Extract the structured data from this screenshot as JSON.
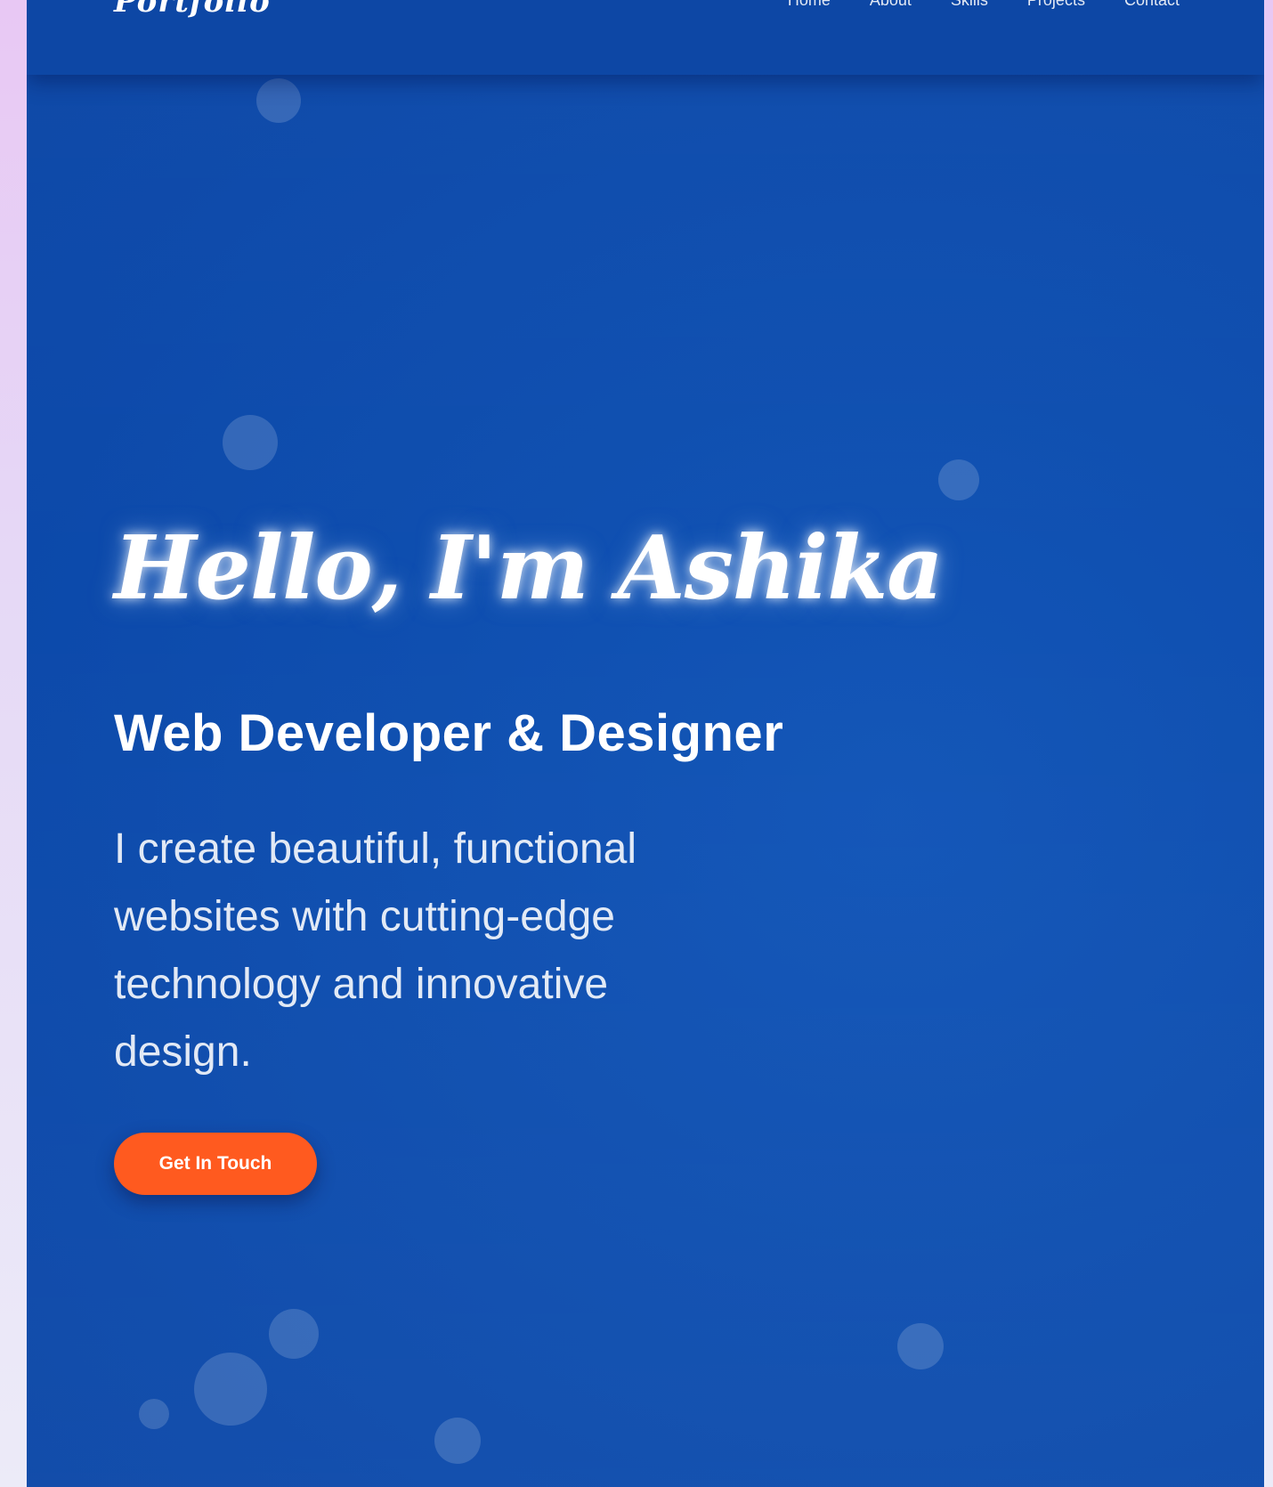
{
  "brand": {
    "logo_text": "Portfolio"
  },
  "nav": {
    "items": [
      {
        "label": "Home"
      },
      {
        "label": "About"
      },
      {
        "label": "Skills"
      },
      {
        "label": "Projects"
      },
      {
        "label": "Contact"
      }
    ]
  },
  "hero": {
    "greeting": "Hello, I'm Ashika",
    "role": "Web Developer & Designer",
    "description": "I create beautiful, functional websites with cutting-edge technology and innovative design.",
    "cta_label": "Get In Touch"
  },
  "colors": {
    "background": "#0f4fb0",
    "accent": "#ff5a1f",
    "page_backdrop": "#e8d4f5"
  }
}
